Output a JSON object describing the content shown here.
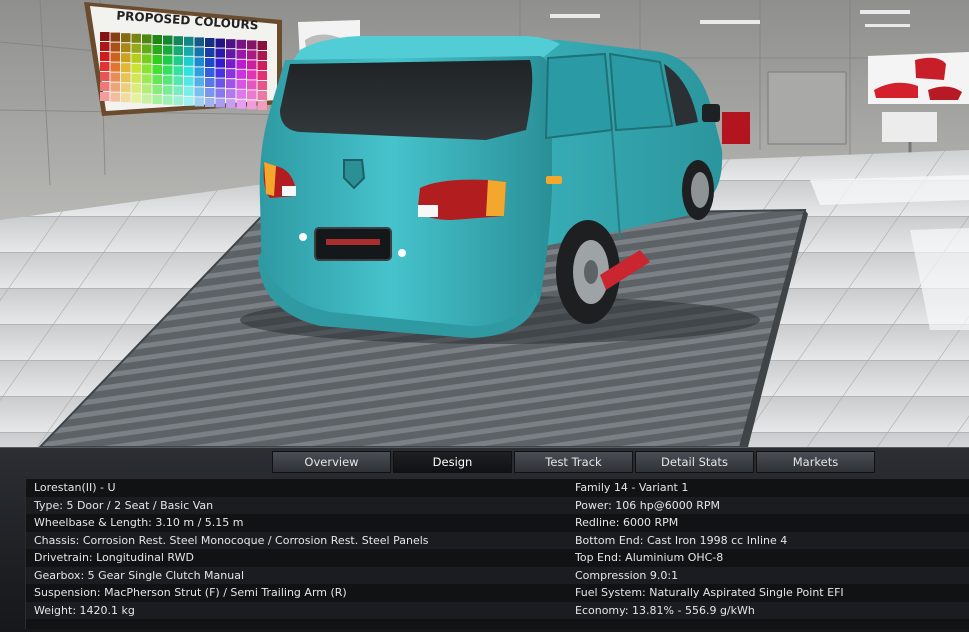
{
  "scene": {
    "poster_title": "PROPOSED COLOURS",
    "van_color": "#3bb2bb"
  },
  "tabs": [
    {
      "label": "Overview",
      "active": false
    },
    {
      "label": "Design",
      "active": true
    },
    {
      "label": "Test Track",
      "active": false
    },
    {
      "label": "Detail Stats",
      "active": false
    },
    {
      "label": "Markets",
      "active": false
    }
  ],
  "stats": {
    "left": [
      "Lorestan(II) - U",
      "Type: 5 Door / 2 Seat / Basic Van",
      "Wheelbase & Length: 3.10 m / 5.15 m",
      "Chassis: Corrosion Rest. Steel Monocoque / Corrosion Rest. Steel Panels",
      "Drivetrain: Longitudinal RWD",
      "Gearbox: 5 Gear Single Clutch Manual",
      "Suspension: MacPherson Strut (F) / Semi Trailing Arm (R)",
      "Weight: 1420.1 kg"
    ],
    "right": [
      "Family 14 - Variant 1",
      "Power: 106 hp@6000 RPM",
      "Redline: 6000 RPM",
      "Bottom End: Cast Iron 1998 cc Inline 4",
      "Top End: Aluminium OHC-8",
      "Compression 9.0:1",
      "Fuel System: Naturally Aspirated Single Point EFI",
      "Economy: 13.81% - 556.9 g/kWh"
    ]
  }
}
